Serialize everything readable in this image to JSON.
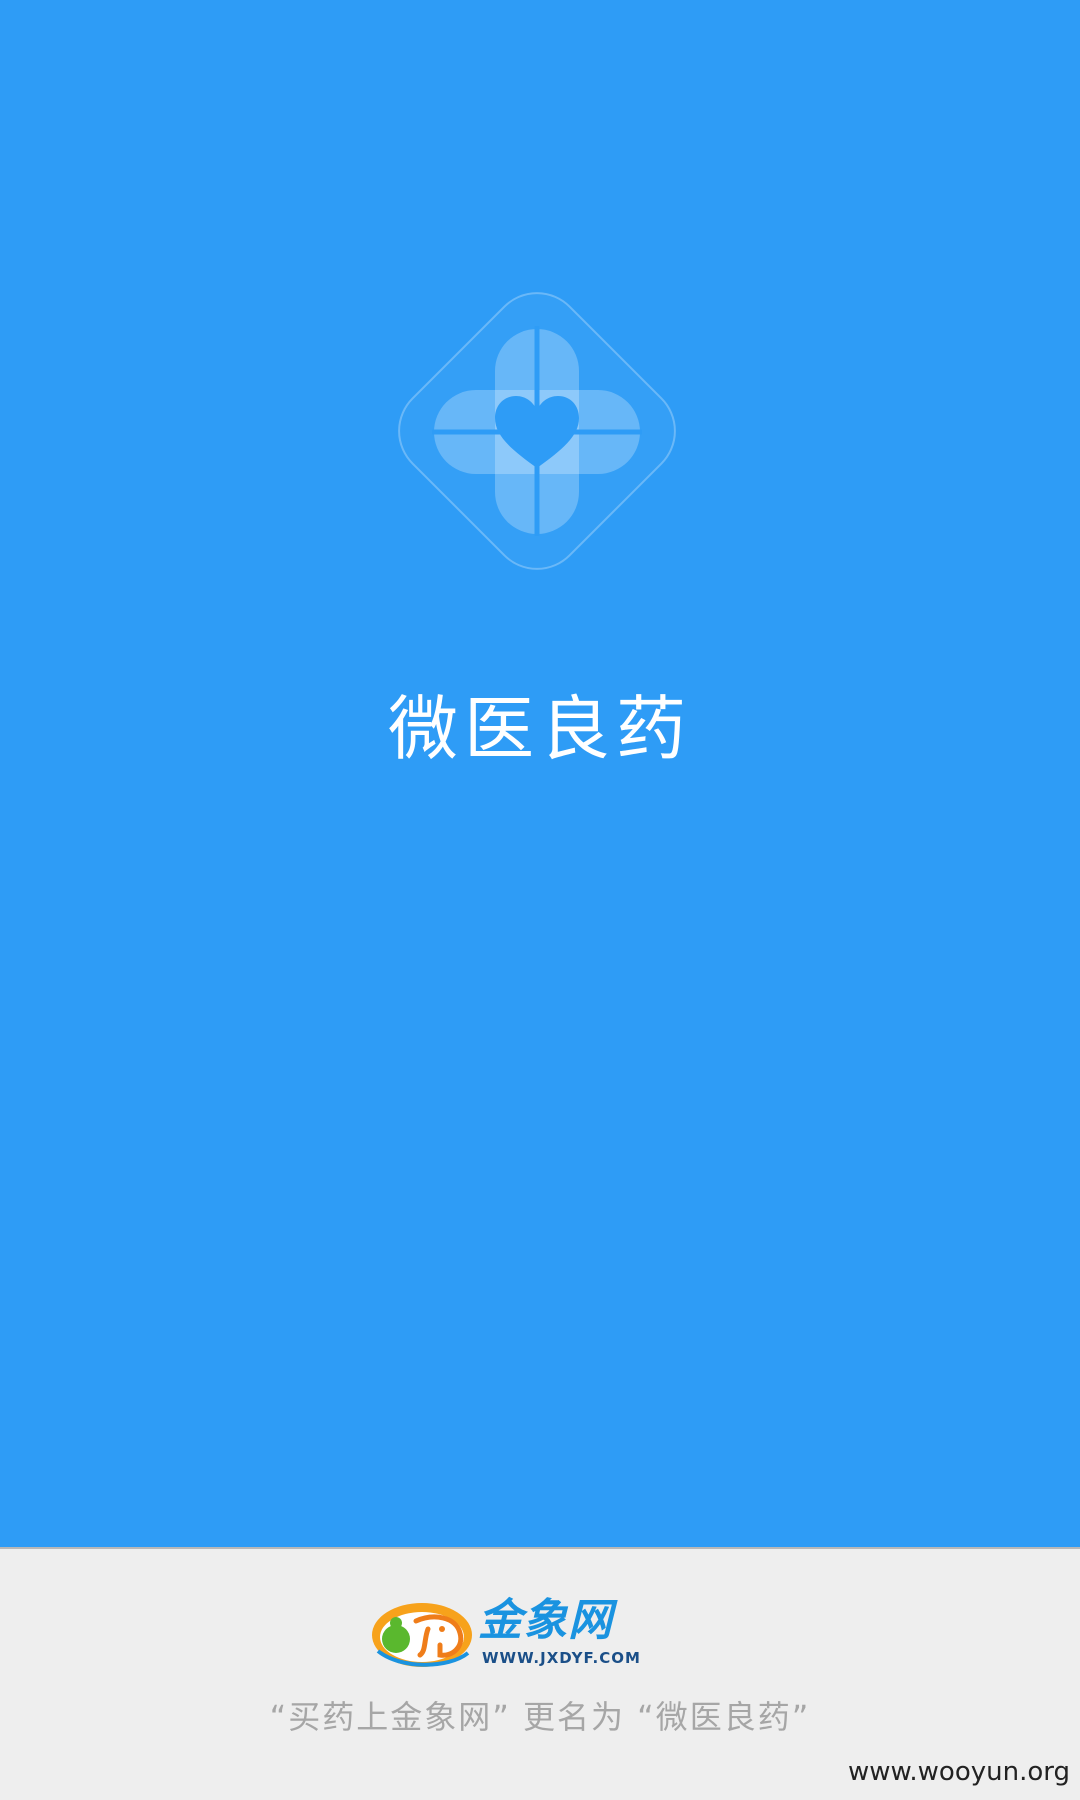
{
  "splash": {
    "app_name": "微医良药",
    "logo_icon": "heart-cross-icon",
    "background_color": "#2e9cf6"
  },
  "footer": {
    "partner_name": "金象网",
    "partner_url": "WWW.JXDYF.COM",
    "partner_icon": "elephant-icon",
    "rename_notice": "“买药上金象网” 更名为 “微医良药”",
    "background_color": "#eeeeee"
  },
  "watermark": "www.wooyun.org"
}
